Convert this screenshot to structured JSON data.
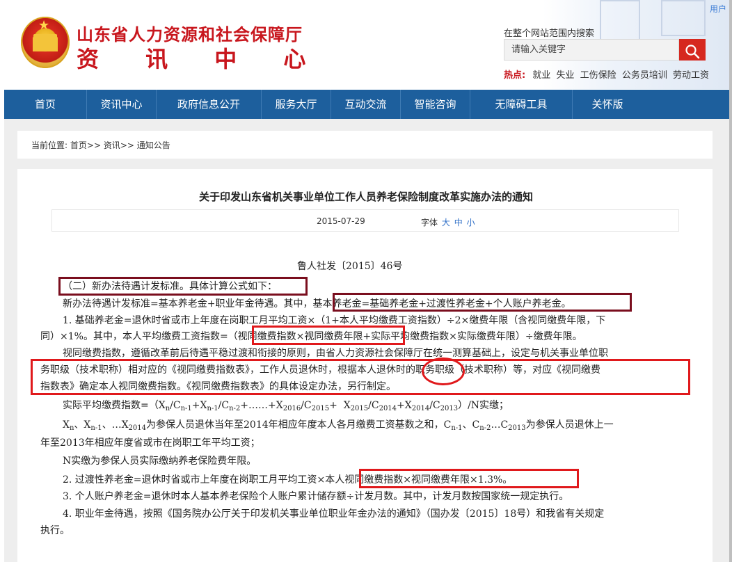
{
  "header": {
    "title": "山东省人力资源和社会保障厅",
    "subtitle": "资 讯 中 心",
    "user_link": "用户",
    "search": {
      "label": "在整个网站范围内搜索",
      "placeholder": "请输入关键字"
    },
    "hot": {
      "label": "热点:",
      "items": [
        "就业",
        "失业",
        "工伤保险",
        "公务员培训",
        "劳动工资"
      ]
    }
  },
  "nav": [
    {
      "label": "首页"
    },
    {
      "label": "资讯中心"
    },
    {
      "label": "政府信息公开"
    },
    {
      "label": "服务大厅"
    },
    {
      "label": "互动交流"
    },
    {
      "label": "智能咨询"
    },
    {
      "label": "无障碍工具"
    },
    {
      "label": "关怀版"
    }
  ],
  "breadcrumb": {
    "prefix": "当前位置:",
    "items": [
      "首页",
      "资讯",
      "通知公告"
    ],
    "sep": ">>"
  },
  "article": {
    "title": "关于印发山东省机关事业单位工作人员养老保险制度改革实施办法的通知",
    "date": "2015-07-29",
    "font_label": "字体",
    "font_sizes": [
      "大",
      "中",
      "小"
    ],
    "doc_number": "鲁人社发〔2015〕46号",
    "p1": "（二）新办法待遇计发标准。具体计算公式如下：",
    "p2": "新办法待遇计发标准=基本养老金+职业年金待遇。其中，基本养老金=基础养老金+过渡性养老金+个人账户养老金。",
    "p3a": "1. 基础养老金=退休时省或市上年度在岗职工月平均工资×（1+本人平均缴费工资指数）÷2×缴费年限（含视同缴费年限，下",
    "p3b": "同）×1%。其中，本人平均缴费工资指数=（视同缴费指数×视同缴费年限+实际平均缴费指数×实际缴费年限）÷缴费年限。",
    "p4a": "视同缴费指数，遵循改革前后待遇平稳过渡和衔接的原则，由省人力资源社会保障厅在统一测算基础上，设定与机关事业单位职",
    "p4b": "务职级（技术职称）相对应的《视同缴费指数表》，工作人员退休时，根据本人退休时的职务职级（技术职称）等，对应《视同缴费",
    "p4c": "指数表》确定本人视同缴费指数。《视同缴费指数表》的具体设定办法，另行制定。",
    "f_label": "实际平均缴费指数=",
    "f_items": [
      "（X",
      "n",
      "/C",
      "n-1",
      "+X",
      "n-1",
      "/C",
      "n-2",
      "+……+X",
      "2016",
      "/C",
      "2015",
      "+  X",
      "2015",
      "/C",
      "2014",
      "+X",
      "2014",
      "/C",
      "2013",
      "）/N实缴；"
    ],
    "x_items": [
      "X",
      "n",
      "、X",
      "n-1",
      "、…X",
      "2014",
      "为参保人员退休当年至2014年相应年度本人各月缴费工资基数之和，C",
      "n-1",
      "、C",
      "n-2",
      "…C",
      "2013",
      "为参保人员退休上一"
    ],
    "x2": "年至2013年相应年度省或市在岗职工年平均工资；",
    "n_line": "N实缴为参保人员实际缴纳养老保险费年限。",
    "p5": "2. 过渡性养老金=退休时省或市上年度在岗职工月平均工资×本人视同缴费指数×视同缴费年限×1.3%。",
    "p6": "3. 个人账户养老金=退休时本人基本养老保险个人账户累计储存额÷计发月数。其中，计发月数按国家统一规定执行。",
    "p7a": "4. 职业年金待遇，按照《国务院办公厅关于印发机关事业单位职业年金办法的通知》（国办发〔2015〕18号）和我省有关规定",
    "p7b": "执行。"
  },
  "colors": {
    "brand_red": "#c8161d",
    "nav_blue": "#1d5f9d",
    "annot_red": "#e0191c",
    "annot_maroon": "#7a0e1e"
  }
}
